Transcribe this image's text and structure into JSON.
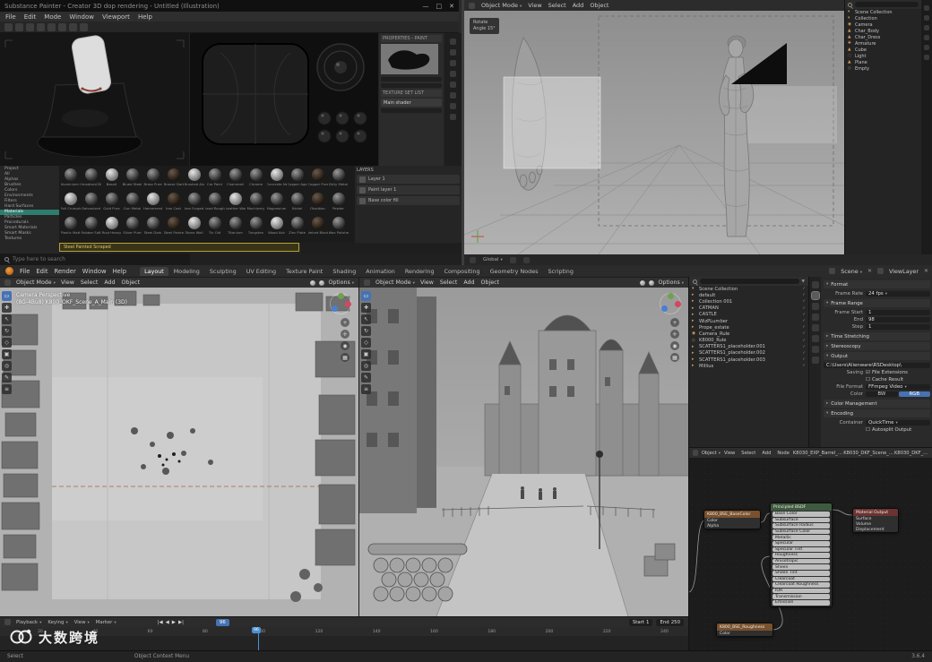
{
  "colors": {
    "accent_blue": "#4772b3",
    "blender_orange": "#e8862c",
    "sp_selection_teal": "#2e7d6e",
    "warning_yellow": "#b5a13c"
  },
  "sp": {
    "title": "Substance Painter - Creator 3D dop rendering - Untitled (Illustration)",
    "window_controls": {
      "minimize": "—",
      "maximize": "□",
      "close": "✕"
    },
    "menus": [
      "File",
      "Edit",
      "Mode",
      "Window",
      "Viewport",
      "Help"
    ],
    "panels": {
      "properties_title": "PROPERTIES - PAINT",
      "texture_set_title": "TEXTURE SET LIST",
      "texture_set_item": "Main shader",
      "layers_title": "LAYERS",
      "layers": [
        "Layer 1",
        "Paint layer 1",
        "Base color fill"
      ]
    },
    "shelf": {
      "categories": [
        "Project",
        "All",
        "Alphas",
        "Brushes",
        "Colors",
        "Environments",
        "Filters",
        "Hard Surfaces",
        "Materials",
        "Particles",
        "Procedurals",
        "Smart Materials",
        "Smart Masks",
        "Textures"
      ],
      "active_category": "Materials",
      "selected_item": "Steel Painted Scraped",
      "materials": [
        "Aluminium Pure",
        "Anodized Blue",
        "Basalt",
        "Blued Steel",
        "Brass Pure",
        "Bronze Dark",
        "Brushed Alu",
        "Car Paint",
        "Chainmail",
        "Chrome",
        "Concrete New",
        "Copper Aged",
        "Copper Pure",
        "Dirty Metal",
        "Foil Crumpled",
        "Galvanized",
        "Gold Pure",
        "Gun Metal",
        "Hammered",
        "Iron Cast",
        "Iron Forged",
        "Lead Rough",
        "Leather Worn",
        "Machinery",
        "Magnesium",
        "Nickel",
        "Obsidian",
        "Pewter",
        "Plastic Matte",
        "Rubber Soft",
        "Rust Heavy",
        "Silver Pure",
        "Steel Dark",
        "Steel Painted",
        "Stone Wall",
        "Tin Old",
        "Titanium",
        "Tungsten",
        "Wood Ash",
        "Zinc Plate",
        "Velvet Black",
        "Wax Polished"
      ]
    },
    "search_placeholder": "Type here to search"
  },
  "bl_top": {
    "mode": "Object Mode",
    "menus": [
      "View",
      "Select",
      "Add",
      "Object"
    ],
    "panel": {
      "title": "Rotate",
      "line": "Angle 15°"
    },
    "outliner": {
      "items": [
        {
          "icon": "▾",
          "label": "Scene Collection"
        },
        {
          "icon": "▾",
          "label": "Collection"
        },
        {
          "icon": "◉",
          "label": "Camera"
        },
        {
          "icon": "▲",
          "label": "Char_Body"
        },
        {
          "icon": "▲",
          "label": "Char_Dress"
        },
        {
          "icon": "✚",
          "label": "Armature"
        },
        {
          "icon": "▲",
          "label": "Cube"
        },
        {
          "icon": "◌",
          "label": "Light"
        },
        {
          "icon": "▲",
          "label": "Plane"
        },
        {
          "icon": "◇",
          "label": "Empty"
        }
      ]
    },
    "footer": {
      "orientation": "Global"
    }
  },
  "bl_main": {
    "menus": [
      "File",
      "Edit",
      "Render",
      "Window",
      "Help"
    ],
    "workspaces": [
      "Layout",
      "Modeling",
      "Sculpting",
      "UV Editing",
      "Texture Paint",
      "Shading",
      "Animation",
      "Rendering",
      "Compositing",
      "Geometry Nodes",
      "Scripting"
    ],
    "active_workspace": "Layout",
    "scene": "Scene",
    "view_layer": "ViewLayer",
    "tools": [
      "▭",
      "✚",
      "↖",
      "↻",
      "◇",
      "▣",
      "◎",
      "✎",
      "≡"
    ],
    "active_tool": "▭",
    "nav_icons": [
      "+",
      "✛",
      "◉",
      "▦"
    ],
    "viewport_left": {
      "mode": "Object Mode",
      "menus": [
        "View",
        "Select",
        "Add",
        "Object"
      ],
      "options_label": "Options",
      "overlay_line1": "Camera Perspective",
      "overlay_line2": "(8G-4Bu8) K800_OKF_Scene_A_Main (3D)"
    },
    "viewport_right": {
      "mode": "Object Mode",
      "menus": [
        "View",
        "Select",
        "Add",
        "Object"
      ],
      "options_label": "Options"
    },
    "outliner": {
      "vis": "✓",
      "items": [
        {
          "icon": "▾",
          "label": "Scene Collection"
        },
        {
          "icon": "▸",
          "label": "default"
        },
        {
          "icon": "▸",
          "label": "Collection 001"
        },
        {
          "icon": "▸",
          "label": "CATMAN"
        },
        {
          "icon": "▸",
          "label": "CASTLE"
        },
        {
          "icon": "▸",
          "label": "WizPLumber"
        },
        {
          "icon": "▸",
          "label": "Prope_estate"
        },
        {
          "icon": "◉",
          "label": "Camera_Rule"
        },
        {
          "icon": "◇",
          "label": "K8000_Rule"
        },
        {
          "icon": "▸",
          "label": "SCATTERS1_placeholder.001"
        },
        {
          "icon": "▸",
          "label": "SCATTERS1_placeholder.002"
        },
        {
          "icon": "▸",
          "label": "SCATTERS1_placeholder.003"
        },
        {
          "icon": "▸",
          "label": "Millius"
        }
      ]
    },
    "properties": {
      "format_section": "Format",
      "frame_rate_label": "Frame Rate",
      "frame_rate": "24 fps",
      "frame_range_section": "Frame Range",
      "frame_start_label": "Frame Start",
      "frame_start": "1",
      "frame_end_label": "End",
      "frame_end": "98",
      "frame_step_label": "Step",
      "frame_step": "1",
      "time_stretching": "Time Stretching",
      "stereoscopy": "Stereoscopy",
      "output_section": "Output",
      "output_path": "C:\\Users\\Alienware\\RSDesktop\\",
      "saving_label": "Saving",
      "file_extensions": "File Extensions",
      "cache_result": "Cache Result",
      "file_format_label": "File Format",
      "file_format": "FFmpeg Video",
      "color_label": "Color",
      "color_bw": "BW",
      "color_rgb": "RGB",
      "color_management": "Color Management",
      "encoding_section": "Encoding",
      "container_label": "Container",
      "container": "QuickTime",
      "autosplit": "Autosplit Output",
      "check_on": "☑",
      "check_off": "☐"
    },
    "node_editor": {
      "type_label": "Object",
      "menus": [
        "View",
        "Select",
        "Add",
        "Node"
      ],
      "breadcrumb": [
        "K8030_EXP_Barrel_A_Main.002",
        "K8030_DKF_Scene_A_Main.001",
        "K8030_DKF_Metarih"
      ],
      "nodes": {
        "tex1": {
          "title": "K800_BSE_BaseColor",
          "rows": [
            "Color",
            "Alpha"
          ]
        },
        "bsdf": {
          "title": "Principled BSDF",
          "rows": [
            "Base Color",
            "Subsurface",
            "Subsurface Radius",
            "Subsurface Color",
            "Metallic",
            "Specular",
            "Specular Tint",
            "Roughness",
            "Anisotropic",
            "Sheen",
            "Sheen Tint",
            "Clearcoat",
            "Clearcoat Roughness",
            "IOR",
            "Transmission",
            "Emission"
          ]
        },
        "out": {
          "title": "Material Output",
          "rows": [
            "Surface",
            "Volume",
            "Displacement"
          ]
        },
        "tex2": {
          "title": "K800_BSE_Roughness",
          "rows": [
            "Color"
          ]
        }
      }
    },
    "timeline": {
      "menus": [
        "Playback",
        "Keying",
        "View",
        "Marker"
      ],
      "transport": [
        "|◀",
        "◀",
        "▶",
        "▶|"
      ],
      "current": "96",
      "start_label": "Start",
      "start": "1",
      "end_label": "End",
      "end": "250",
      "ticks": [
        "20",
        "40",
        "60",
        "80",
        "100",
        "120",
        "140",
        "160",
        "180",
        "200",
        "220",
        "240"
      ]
    },
    "status": {
      "left": "Select",
      "mid": "Object Context Menu",
      "right": "3.6.4"
    }
  },
  "watermark": {
    "text": "大数跨境"
  }
}
